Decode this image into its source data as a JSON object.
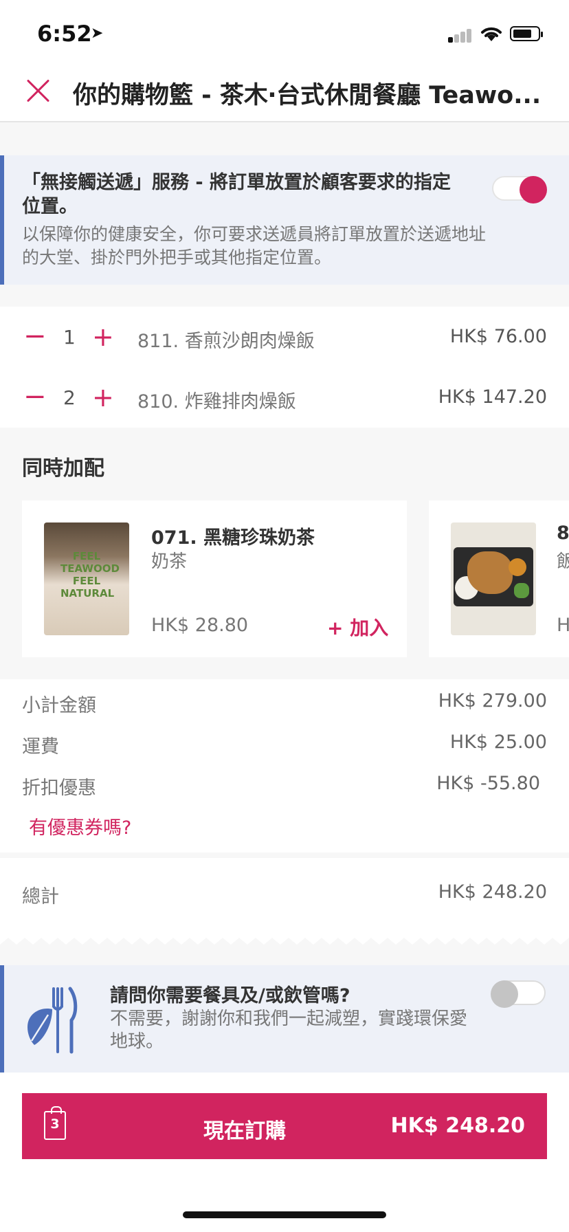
{
  "status_bar": {
    "time": "6:52"
  },
  "header": {
    "title": "你的購物籃 - 茶木‧台式休閒餐廳 Teawo..."
  },
  "contactless": {
    "title": "「無接觸送遞」服務 - 將訂單放置於顧客要求的指定位置。",
    "description": "以保障你的健康安全，你可要求送遞員將訂單放置於送遞地址的大堂、掛於門外把手或其他指定位置。",
    "enabled": true
  },
  "cart_items": [
    {
      "qty": "1",
      "name": "811. 香煎沙朗肉燥飯",
      "price": "HK$ 76.00"
    },
    {
      "qty": "2",
      "name": "810. 炸雞排肉燥飯",
      "price": "HK$ 147.20"
    }
  ],
  "controls": {
    "minus": "−",
    "plus": "+"
  },
  "addons": {
    "title": "同時加配",
    "items": [
      {
        "name": "071. 黑糖珍珠奶茶",
        "category": "奶茶",
        "price": "HK$ 28.80",
        "add_label": "+ 加入",
        "image_text": "FEEL TEAWOOD FEEL NATURAL"
      },
      {
        "name": "8",
        "category": "飯",
        "price": "H"
      }
    ]
  },
  "summary": {
    "subtotal_label": "小計金額",
    "subtotal": "HK$ 279.00",
    "delivery_label": "運費",
    "delivery": "HK$ 25.00",
    "discount_label": "折扣優惠",
    "discount": "HK$ -55.80",
    "coupon_link": "有優惠券嗎?",
    "total_label": "總計",
    "total": "HK$ 248.20"
  },
  "cutlery": {
    "question": "請問你需要餐具及/或飲管嗎?",
    "description": "不需要，謝謝你和我們一起減塑，實踐環保愛地球。",
    "enabled": false
  },
  "order_button": {
    "label": "現在訂購",
    "total": "HK$ 248.20",
    "bag_count": "3"
  },
  "colors": {
    "accent": "#d1245f",
    "info_bar": "#4d6fba",
    "info_bg": "#eef1f8"
  }
}
